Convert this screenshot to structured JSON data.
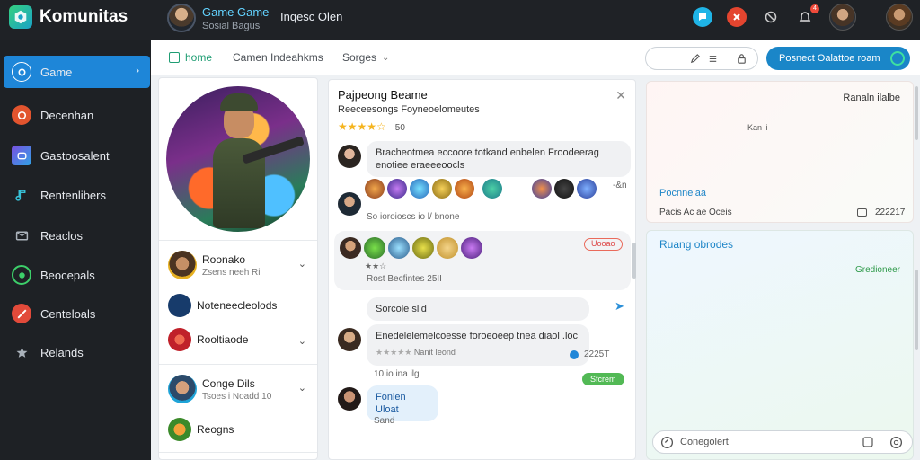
{
  "app": {
    "name": "Komunitas"
  },
  "topbar": {
    "game_title": "Game Game",
    "game_sub": "Sosial Bagus",
    "game_extra": "Inqesc Olen",
    "notification_count": "4"
  },
  "sidebar": {
    "items": [
      {
        "label": "Game",
        "icon": "controller-icon",
        "active": true
      },
      {
        "label": "Decenhan",
        "icon": "shield-icon"
      },
      {
        "label": "Gastoosalent",
        "icon": "gamepad-icon"
      },
      {
        "label": "Rentenlibers",
        "icon": "music-icon"
      },
      {
        "label": "Reaclos",
        "icon": "mail-icon"
      },
      {
        "label": "Beocepals",
        "icon": "globe-icon"
      },
      {
        "label": "Centeloals",
        "icon": "sword-icon"
      },
      {
        "label": "Relands",
        "icon": "star-icon"
      }
    ]
  },
  "tabs": {
    "home": "home",
    "games": "Camen Indeahkms",
    "more": "Sorges",
    "cta": "Posnect Oalattoe roam"
  },
  "profile": {
    "items": [
      {
        "name": "Roonako",
        "sub": "Zsens neeh Ri"
      },
      {
        "name": "Noteneecleolods",
        "sub": ""
      },
      {
        "name": "Rooltiaode",
        "sub": ""
      },
      {
        "name": "Conge Dils",
        "sub": "Tsoes i Noadd 10"
      },
      {
        "name": "Reogns",
        "sub": ""
      }
    ]
  },
  "chat": {
    "title": "Pajpeong Beame",
    "subtitle": "Reeceesongs Foyneoelomeutes",
    "stars": "★★★★☆",
    "rating_count": "50",
    "messages": [
      {
        "text": "Bracheotmea eccoore totkand enbelen Froodeerag enotiee eraeeeoocls"
      },
      {
        "meta": "So ioroioscs io l/ bnone",
        "side": "-&n"
      },
      {
        "pill": "Uooao",
        "meta": "Rost Becfintes 25II"
      },
      {
        "text": "Sorcole slid"
      },
      {
        "text": "Enedelelemelcoesse foroeoeep tnea diaol .loc",
        "sub": "Nanit Ieond",
        "time": "2225T"
      },
      {
        "meta": "10 io ina ilg",
        "pill": "Sfcrem"
      },
      {
        "text": "Fonien Uloat",
        "meta": "Sand"
      }
    ]
  },
  "right": {
    "panel1": {
      "title": "Ranaln ilalbe",
      "mid": "Kan ii",
      "link": "Pocnnelaa",
      "foot": "Pacis Ac ae Oceis",
      "time": "222217"
    },
    "panel2": {
      "title": "Ruang obrodes",
      "status": "Gredioneer"
    },
    "compose_placeholder": "Conegolert"
  }
}
